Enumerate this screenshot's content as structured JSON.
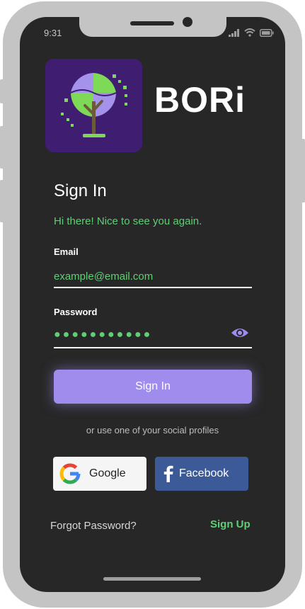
{
  "status_bar": {
    "time": "9:31"
  },
  "brand": {
    "name": "BORi"
  },
  "signin": {
    "title": "Sign In",
    "subtitle": "Hi there! Nice to see you again.",
    "email_label": "Email",
    "email_placeholder": "example@email.com",
    "password_label": "Password",
    "password_value": "●●●●●●●●●●●",
    "button_label": "Sign In",
    "social_caption": "or use one of your social profiles",
    "google_label": "Google",
    "facebook_label": "Facebook",
    "forgot_label": "Forgot Password?",
    "signup_label": "Sign Up"
  },
  "colors": {
    "background": "#272727",
    "accent_green": "#5fce75",
    "accent_purple": "#9f8cec",
    "logo_bg": "#3f1e72",
    "facebook_blue": "#3d5a98"
  },
  "icons": [
    "tree-logo-icon",
    "signal-icon",
    "wifi-icon",
    "battery-icon",
    "eye-icon",
    "google-icon",
    "facebook-icon"
  ]
}
